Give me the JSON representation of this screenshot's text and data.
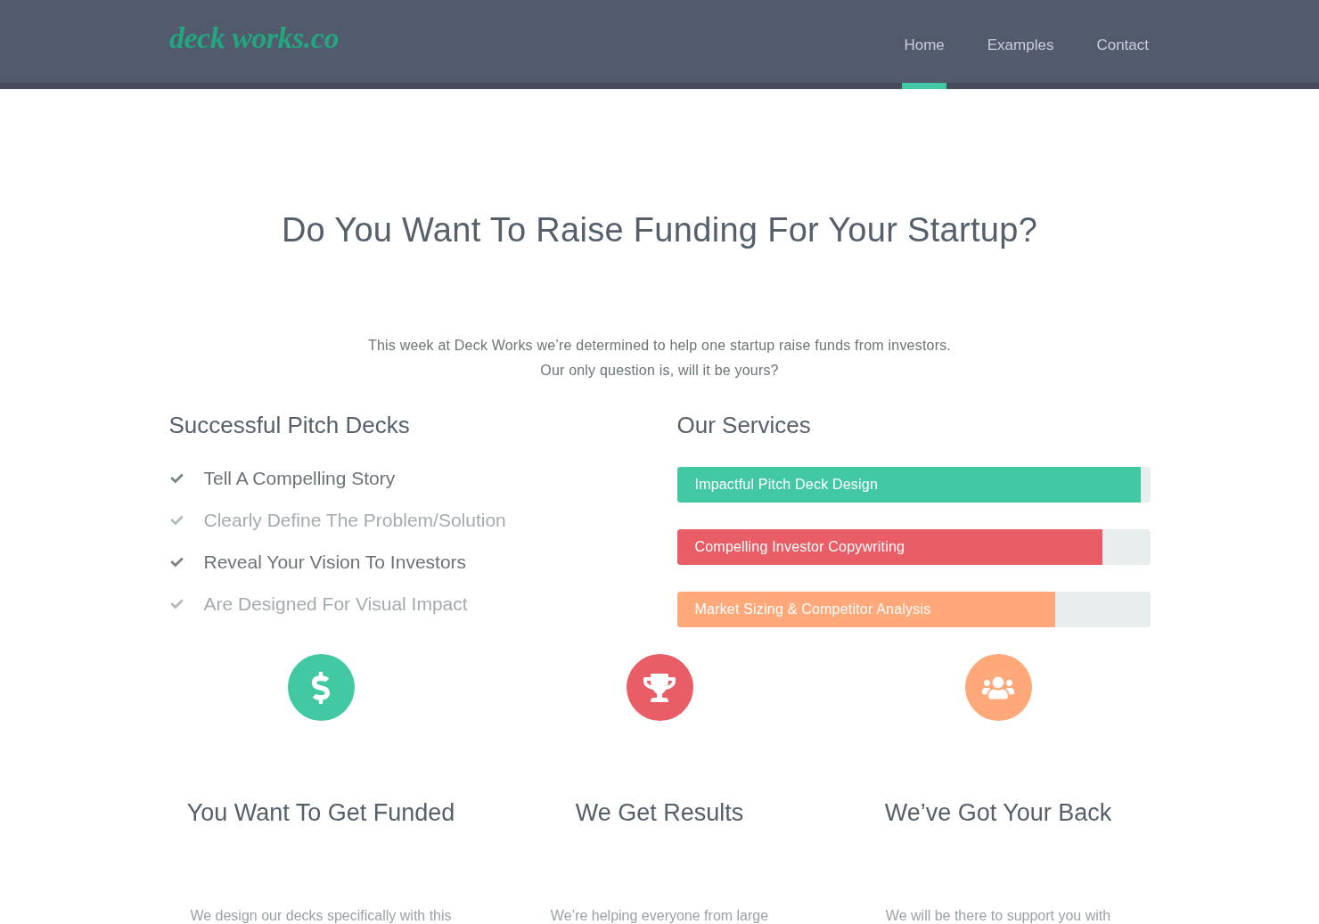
{
  "header": {
    "logo": "deck works.co",
    "nav": [
      {
        "label": "Home",
        "selected": true
      },
      {
        "label": "Examples",
        "selected": false
      },
      {
        "label": "Contact",
        "selected": false
      }
    ]
  },
  "hero": {
    "title": "Do You Want To Raise Funding For Your Startup?",
    "intro_lines": [
      "This week at Deck Works we’re determined to help one startup raise funds from investors.",
      "Our only question is, will it be yours?"
    ]
  },
  "pitch_decks": {
    "heading": "Successful Pitch Decks",
    "items": [
      {
        "label": "Tell A Compelling Story",
        "dimmed": false
      },
      {
        "label": "Clearly Define The Problem/Solution",
        "dimmed": true
      },
      {
        "label": "Reveal Your Vision To Investors",
        "dimmed": false
      },
      {
        "label": "Are Designed For Visual Impact",
        "dimmed": true
      }
    ]
  },
  "services": {
    "heading": "Our Services",
    "bars": [
      {
        "label": "Impactful Pitch Deck Design",
        "level": 0.98,
        "color": "#42c9a3"
      },
      {
        "label": "Compelling Investor Copywriting",
        "level": 0.9,
        "color": "#e85d66"
      },
      {
        "label": "Market Sizing & Competitor Analysis",
        "level": 0.8,
        "color": "#ffa87a"
      }
    ]
  },
  "features": [
    {
      "color": "#42c9a3",
      "title": "You Want To Get Funded",
      "text": "We design our decks specifically with this"
    },
    {
      "color": "#e85d66",
      "title": "We Get Results",
      "text": "We’re helping everyone from large"
    },
    {
      "color": "#ffa87a",
      "title": "We’ve Got Your Back",
      "text": "We will be there to support you with"
    }
  ]
}
